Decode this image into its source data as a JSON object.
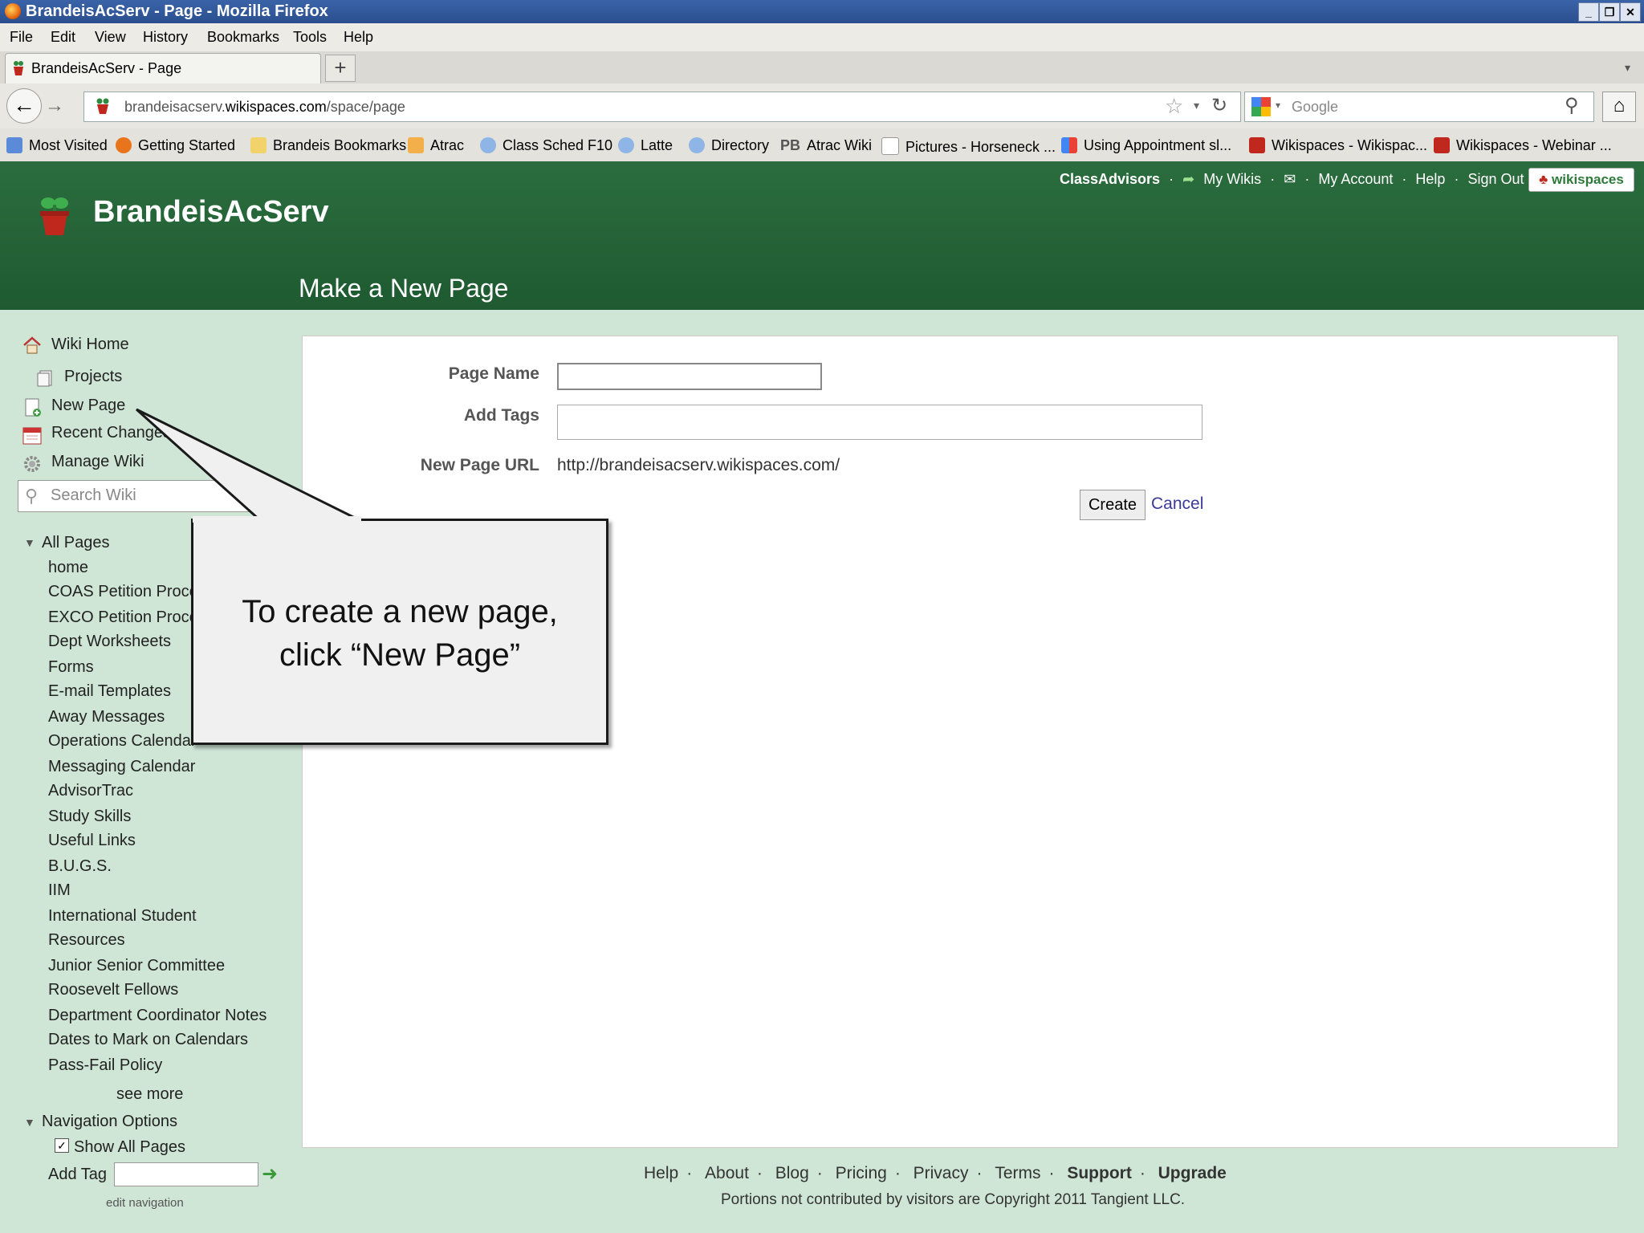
{
  "window": {
    "title": "BrandeisAcServ - Page - Mozilla Firefox"
  },
  "menu": [
    "File",
    "Edit",
    "View",
    "History",
    "Bookmarks",
    "Tools",
    "Help"
  ],
  "tab": {
    "label": "BrandeisAcServ - Page",
    "new_tab": "+"
  },
  "nav": {
    "url_plain": "brandeisacserv.",
    "url_domain": "wikispaces.com",
    "url_path": "/space/page",
    "search_placeholder": "Google"
  },
  "bookmarks": [
    "Most Visited",
    "Getting Started",
    "Brandeis Bookmarks",
    "Atrac",
    "Class Sched F10",
    "Latte",
    "Directory",
    "Atrac Wiki",
    "Pictures - Horseneck ...",
    "Using Appointment sl...",
    "Wikispaces - Wikispac...",
    "Wikispaces - Webinar ..."
  ],
  "bookmark_pb": "PB",
  "header": {
    "site_name": "BrandeisAcServ",
    "page_heading": "Make a New Page",
    "user": "ClassAdvisors",
    "my_wikis": "My Wikis",
    "my_account": "My Account",
    "help": "Help",
    "sign_out": "Sign Out",
    "sep": "·",
    "badge": "wikispaces"
  },
  "sidebar": {
    "wiki_home": "Wiki Home",
    "projects": "Projects",
    "new_page": "New Page",
    "recent_changes": "Recent Changes",
    "manage_wiki": "Manage Wiki",
    "search_placeholder": "Search Wiki",
    "all_pages": "All Pages",
    "pages": [
      "home",
      "COAS Petition Process",
      "EXCO Petition Process",
      "Dept Worksheets",
      "Forms",
      "E-mail Templates",
      "Away Messages",
      "Operations Calendar",
      "Messaging Calendar",
      "AdvisorTrac",
      "Study Skills",
      "Useful Links",
      "B.U.G.S.",
      "IIM",
      "International Student",
      "Resources",
      "Junior Senior Committee",
      "Roosevelt Fellows",
      "Department Coordinator Notes",
      "Dates to Mark on Calendars",
      "Pass-Fail Policy"
    ],
    "see_more": "see more",
    "navigation_options": "Navigation Options",
    "show_all_pages": "Show All Pages",
    "add_tag": "Add Tag",
    "edit_navigation": "edit navigation"
  },
  "form": {
    "page_name_label": "Page Name",
    "add_tags_label": "Add Tags",
    "new_page_url_label": "New Page URL",
    "new_page_url": "http://brandeisacserv.wikispaces.com/",
    "page_name_value": "",
    "tags_value": "",
    "create": "Create",
    "cancel": "Cancel"
  },
  "callout": {
    "line1": "To create a new page,",
    "line2": "click “New Page”"
  },
  "footer": {
    "links": [
      "Help",
      "About",
      "Blog",
      "Pricing",
      "Privacy",
      "Terms",
      "Support",
      "Upgrade"
    ],
    "copyright": "Portions not contributed by visitors are Copyright 2011 Tangient LLC."
  },
  "colors": {
    "header_green": "#1f5a31",
    "sidebar_bg": "#cfe6d6",
    "link_purple": "#3a3a9a"
  }
}
